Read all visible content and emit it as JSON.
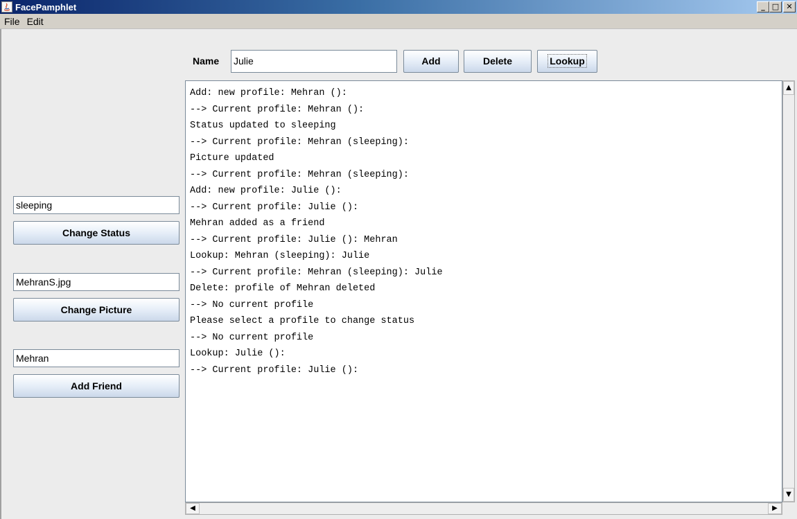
{
  "window": {
    "title": "FacePamphlet",
    "controls": {
      "minimize": "_",
      "maximize": "□",
      "close": "✕"
    }
  },
  "menu": {
    "items": [
      "File",
      "Edit"
    ]
  },
  "toolbar": {
    "name_label": "Name",
    "name_value": "Julie",
    "add_label": "Add",
    "delete_label": "Delete",
    "lookup_label": "Lookup"
  },
  "sidebar": {
    "status_value": "sleeping",
    "change_status_label": "Change Status",
    "picture_value": "MehranS.jpg",
    "change_picture_label": "Change Picture",
    "friend_value": "Mehran",
    "add_friend_label": "Add Friend"
  },
  "log": {
    "lines": [
      "Add: new profile: Mehran ():",
      "--> Current profile: Mehran ():",
      "Status updated to sleeping",
      "--> Current profile: Mehran (sleeping):",
      "Picture updated",
      "--> Current profile: Mehran (sleeping):",
      "Add: new profile: Julie ():",
      "--> Current profile: Julie ():",
      "Mehran added as a friend",
      "--> Current profile: Julie (): Mehran",
      "Lookup: Mehran (sleeping): Julie",
      "--> Current profile: Mehran (sleeping): Julie",
      "Delete: profile of Mehran deleted",
      "--> No current profile",
      "Please select a profile to change status",
      "--> No current profile",
      "Lookup: Julie ():",
      "--> Current profile: Julie ():"
    ]
  },
  "scrollbars": {
    "up_icon": "▲",
    "down_icon": "▼",
    "left_icon": "◀",
    "right_icon": "▶"
  }
}
